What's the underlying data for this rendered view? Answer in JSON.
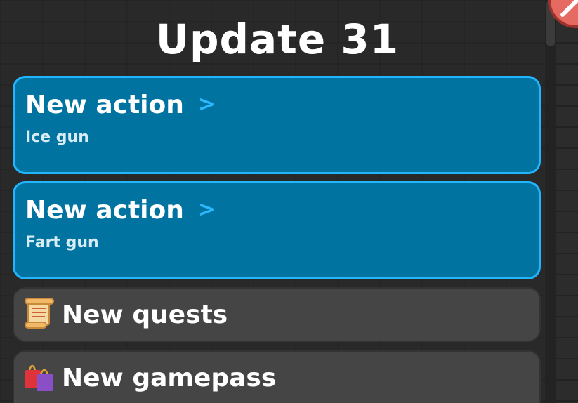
{
  "title": "Update 31",
  "cards": [
    {
      "heading": "New action",
      "chevron": ">",
      "subtitle": "Ice gun"
    },
    {
      "heading": "New action",
      "chevron": ">",
      "subtitle": "Fart gun"
    }
  ],
  "sections": [
    {
      "heading": "New quests",
      "icon": "scroll-icon"
    },
    {
      "heading": "New gamepass",
      "icon": "shopping-bags-icon"
    }
  ],
  "colors": {
    "action_card": "#0073a0",
    "action_border": "#22b6ff",
    "info_card": "#454545",
    "close_button": "#e56a62"
  }
}
